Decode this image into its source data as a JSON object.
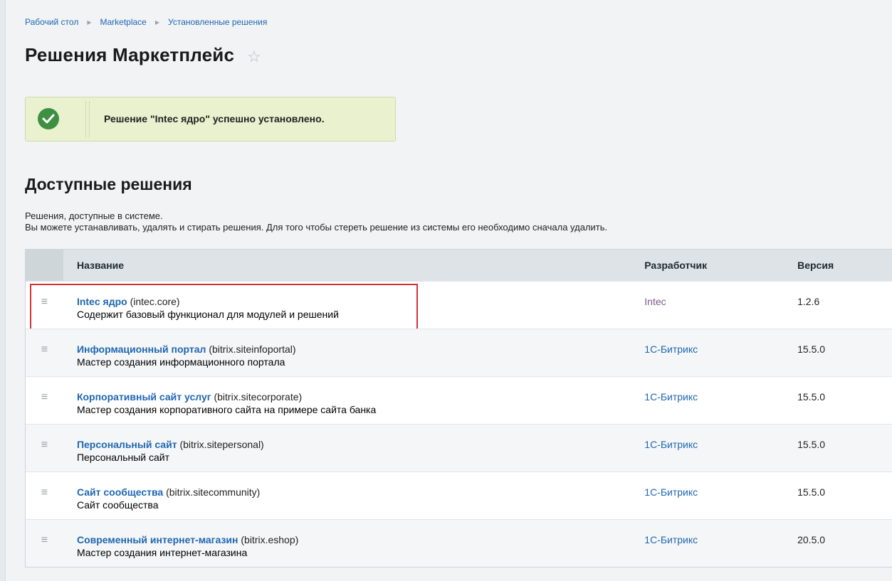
{
  "breadcrumb": [
    "Рабочий стол",
    "Marketplace",
    "Установленные решения"
  ],
  "page_title": "Решения Маркетплейс",
  "notice": {
    "message": "Решение \"Intec ядро\" успешно установлено."
  },
  "section": {
    "title": "Доступные решения",
    "desc_line1": "Решения, доступные в системе.",
    "desc_line2": "Вы можете устанавливать, удалять и стирать решения. Для того чтобы стереть решение из системы его необходимо сначала удалить."
  },
  "table": {
    "headers": {
      "name": "Название",
      "developer": "Разработчик",
      "version": "Версия"
    },
    "rows": [
      {
        "name": "Intec ядро",
        "code": "(intec.core)",
        "description": "Содержит базовый функционал для модулей и решений",
        "developer": "Intec",
        "version": "1.2.6"
      },
      {
        "name": "Информационный портал",
        "code": "(bitrix.siteinfoportal)",
        "description": "Мастер создания информационного портала",
        "developer": "1С-Битрикс",
        "version": "15.5.0"
      },
      {
        "name": "Корпоративный сайт услуг",
        "code": "(bitrix.sitecorporate)",
        "description": "Мастер создания корпоративного сайта на примере сайта банка",
        "developer": "1С-Битрикс",
        "version": "15.5.0"
      },
      {
        "name": "Персональный сайт",
        "code": "(bitrix.sitepersonal)",
        "description": "Персональный сайт",
        "developer": "1С-Битрикс",
        "version": "15.5.0"
      },
      {
        "name": "Сайт сообщества",
        "code": "(bitrix.sitecommunity)",
        "description": "Сайт сообщества",
        "developer": "1С-Битрикс",
        "version": "15.5.0"
      },
      {
        "name": "Современный интернет-магазин",
        "code": "(bitrix.eshop)",
        "description": "Мастер создания интернет-магазина",
        "developer": "1С-Битрикс",
        "version": "20.5.0"
      }
    ]
  },
  "icons": {
    "favorite": "star-icon",
    "success": "check-icon",
    "row_menu": "menu-icon"
  },
  "colors": {
    "link": "#2067b0",
    "success_bg": "#e9f1cf",
    "success_icon": "#3f8f43",
    "highlight": "#d4303a"
  }
}
